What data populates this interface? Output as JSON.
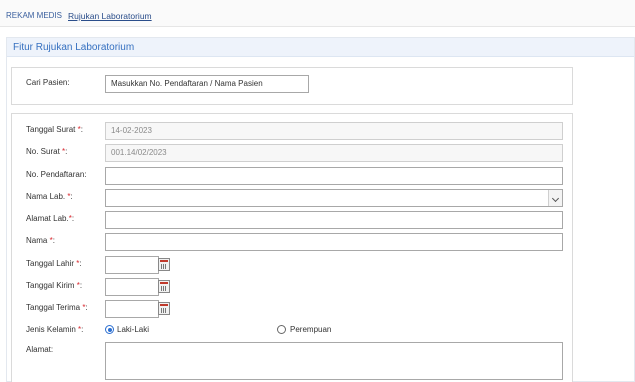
{
  "breadcrumb": {
    "root": "REKAM MEDIS",
    "current": "Rujukan Laboratorium"
  },
  "panel": {
    "title": "Fitur Rujukan Laboratorium"
  },
  "search": {
    "label": "Cari Pasien:",
    "placeholder": "Masukkan No. Pendaftaran / Nama Pasien"
  },
  "form": {
    "tanggal_surat": {
      "label": "Tanggal Surat",
      "value": "14-02-2023"
    },
    "no_surat": {
      "label": "No. Surat",
      "value": "001.14/02/2023"
    },
    "no_pendaftaran": {
      "label": "No. Pendaftaran:",
      "value": ""
    },
    "nama_lab": {
      "label": "Nama Lab.",
      "value": ""
    },
    "alamat_lab": {
      "label": "Alamat Lab.",
      "value": ""
    },
    "nama": {
      "label": "Nama",
      "value": ""
    },
    "tanggal_lahir": {
      "label": "Tanggal Lahir",
      "value": ""
    },
    "tanggal_kirim": {
      "label": "Tanggal Kirim",
      "value": ""
    },
    "tanggal_terima": {
      "label": "Tanggal Terima",
      "value": ""
    },
    "jenis_kelamin": {
      "label": "Jenis Kelamin",
      "options": [
        "Laki-Laki",
        "Perempuan"
      ],
      "selected": "Laki-Laki"
    },
    "alamat": {
      "label": "Alamat:",
      "value": ""
    }
  },
  "required_mark": "*",
  "colors": {
    "accent": "#3570c0",
    "required": "#d9272e",
    "panel_header": "#eef3fb"
  }
}
